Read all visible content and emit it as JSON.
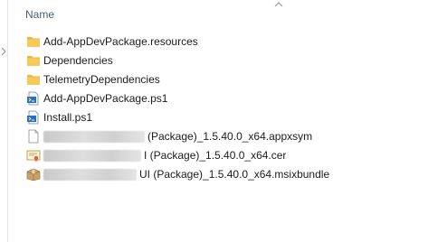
{
  "header": {
    "name_label": "Name"
  },
  "files": [
    {
      "icon": "folder-icon",
      "name": "Add-AppDevPackage.resources",
      "redacted": false
    },
    {
      "icon": "folder-icon",
      "name": "Dependencies",
      "redacted": false
    },
    {
      "icon": "folder-icon",
      "name": "TelemetryDependencies",
      "redacted": false
    },
    {
      "icon": "powershell-script-icon",
      "name": "Add-AppDevPackage.ps1",
      "redacted": false
    },
    {
      "icon": "powershell-script-icon",
      "name": "Install.ps1",
      "redacted": false
    },
    {
      "icon": "blank-file-icon",
      "name": "(Package)_1.5.40.0_x64.appxsym",
      "redacted": true
    },
    {
      "icon": "certificate-icon",
      "name": "I (Package)_1.5.40.0_x64.cer",
      "redacted": true
    },
    {
      "icon": "package-icon",
      "name": "UI (Package)_1.5.40.0_x64.msixbundle",
      "redacted": true
    }
  ],
  "colors": {
    "folder": "#f7c95b",
    "header_text": "#4c607a",
    "text": "#1b1b1b"
  }
}
